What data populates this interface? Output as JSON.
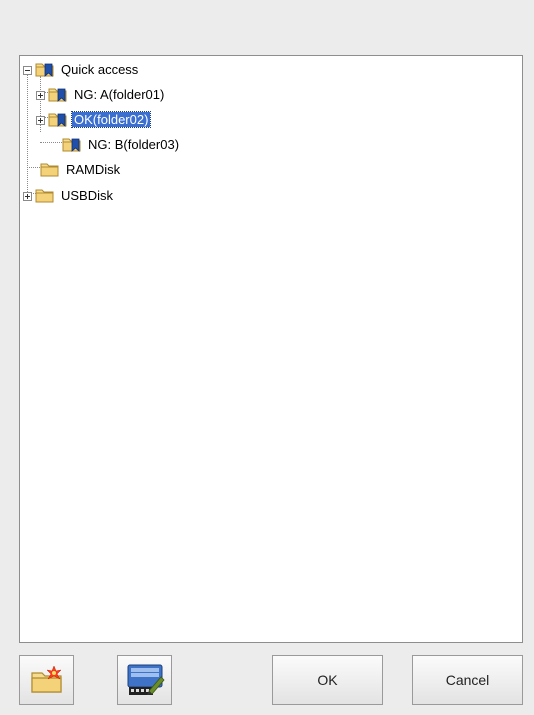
{
  "tree": {
    "root": {
      "label": "Quick access",
      "icon": "quick-access-folder-icon"
    },
    "children": [
      {
        "label": "NG: A(folder01)",
        "icon": "bookmarked-folder-icon",
        "expander": "plus"
      },
      {
        "label": "OK(folder02)",
        "icon": "bookmarked-folder-icon",
        "expander": "plus",
        "selected": true
      },
      {
        "label": "NG: B(folder03)",
        "icon": "bookmarked-folder-icon"
      }
    ],
    "drives": [
      {
        "label": "RAMDisk",
        "icon": "folder-icon"
      },
      {
        "label": "USBDisk",
        "icon": "folder-icon",
        "expander": "plus"
      }
    ]
  },
  "buttons": {
    "new_folder": {
      "icon": "new-folder-icon"
    },
    "keyboard": {
      "icon": "keyboard-edit-icon"
    },
    "ok_label": "OK",
    "cancel_label": "Cancel"
  },
  "colors": {
    "selection": "#3a6fd0",
    "folder": "#f3d27a",
    "bookmark": "#1f4fa8"
  }
}
